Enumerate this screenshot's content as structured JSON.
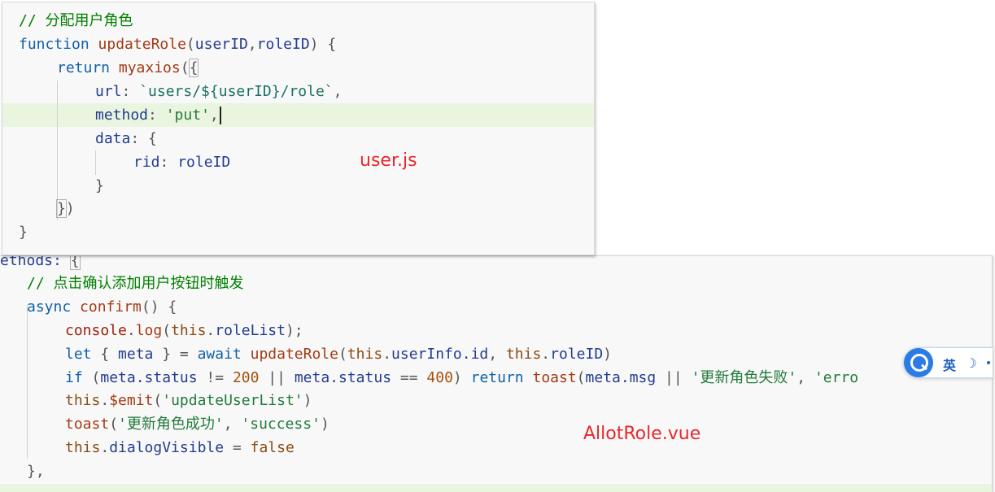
{
  "top_snippet": {
    "comment": "// 分配用户角色",
    "kw_function": "function",
    "fn_name": "updateRole",
    "params_open": "(",
    "param1": "userID",
    "comma": ",",
    "param2": "roleID",
    "params_close": ") {",
    "kw_return": "return",
    "call_name": "myaxios",
    "call_open": "(",
    "call_brace": "{",
    "url_key": "url",
    "colon": ": ",
    "url_value": "`users/${userID}/role`",
    "trail_comma": ",",
    "method_key": "method",
    "method_value": "'put'",
    "data_key": "data",
    "data_open": "{",
    "rid_key": "rid",
    "rid_value": "roleID",
    "inner_close": "}",
    "call_close_brace": "}",
    "call_close_paren": ")",
    "fn_close": "}",
    "file_label": "user.js"
  },
  "bottom_snippet": {
    "methods_fragment": "ethods: ",
    "methods_brace": "{",
    "comment": "// 点击确认添加用户按钮时触发",
    "kw_async": "async",
    "method_name": "confirm",
    "method_sig": "() {",
    "console": "console",
    "dot": ".",
    "log": "log",
    "paren_open": "(",
    "this": "this",
    "roleList": "roleList",
    "paren_close_semi": ");",
    "kw_let": "let",
    "destructure_open": " { ",
    "meta": "meta",
    "destructure_close": " } = ",
    "kw_await": "await",
    "updateRole": "updateRole",
    "userInfo_id": "userInfo.id",
    "arg_sep": ", ",
    "roleID": "roleID",
    "paren_close": ")",
    "kw_if": "if",
    "if_open": " (",
    "meta_status": "meta.status",
    "neq": " != ",
    "num200": "200",
    "or": " || ",
    "eq": " == ",
    "num400": "400",
    "if_close": ") ",
    "kw_return": "return",
    "toast": "toast",
    "meta_msg": "meta.msg",
    "fail_msg": "'更新角色失败'",
    "err_cut": "'erro",
    "emit": "$emit",
    "emit_arg": "'updateUserList'",
    "success_msg": "'更新角色成功'",
    "success_type": "'success'",
    "dialogVisible": "dialogVisible",
    "assign": " = ",
    "false": "false",
    "end_brace": "},",
    "file_label": "AllotRole.vue"
  },
  "ime_toolbar": {
    "language": "英",
    "logo_icon": "search-q-icon",
    "mode_icon": "moon-icon"
  }
}
